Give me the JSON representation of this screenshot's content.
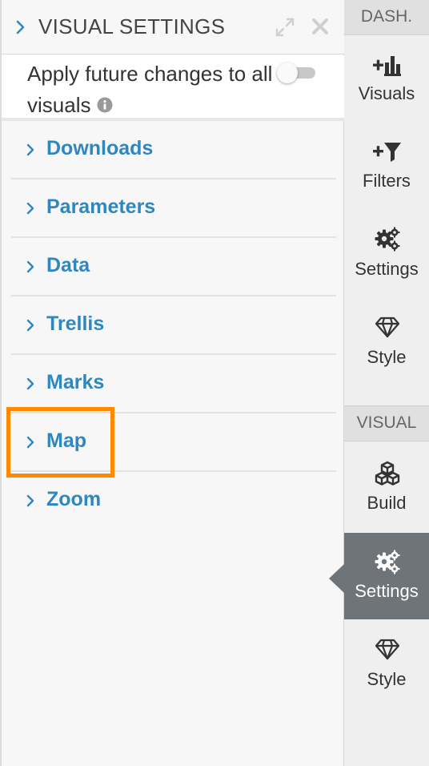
{
  "header": {
    "title": "VISUAL SETTINGS",
    "collapse_icon": "chevron-right-icon",
    "expand_icon": "expand-arrows-icon",
    "close_icon": "close-icon"
  },
  "apply_future": {
    "label": "Apply future changes to all visuals",
    "info_icon": "info-icon",
    "toggle_on": false
  },
  "accordion": [
    {
      "label": "Downloads",
      "icon": "chevron-right-icon"
    },
    {
      "label": "Parameters",
      "icon": "chevron-right-icon"
    },
    {
      "label": "Data",
      "icon": "chevron-right-icon"
    },
    {
      "label": "Trellis",
      "icon": "chevron-right-icon"
    },
    {
      "label": "Marks",
      "icon": "chevron-right-icon"
    },
    {
      "label": "Map",
      "icon": "chevron-right-icon",
      "highlighted": true
    },
    {
      "label": "Zoom",
      "icon": "chevron-right-icon"
    }
  ],
  "rail": {
    "dash_section": "DASH.",
    "dash_items": [
      {
        "label": "Visuals",
        "icon": "add-visual-icon"
      },
      {
        "label": "Filters",
        "icon": "add-filter-icon"
      },
      {
        "label": "Settings",
        "icon": "gears-icon"
      },
      {
        "label": "Style",
        "icon": "diamond-icon"
      }
    ],
    "visual_section": "VISUAL",
    "visual_items": [
      {
        "label": "Build",
        "icon": "cubes-icon"
      },
      {
        "label": "Settings",
        "icon": "gears-icon",
        "active": true
      },
      {
        "label": "Style",
        "icon": "diamond-icon"
      }
    ]
  },
  "colors": {
    "link_blue": "#2f87c0",
    "highlight_orange": "#ff8a00",
    "active_rail": "#6f7478"
  }
}
